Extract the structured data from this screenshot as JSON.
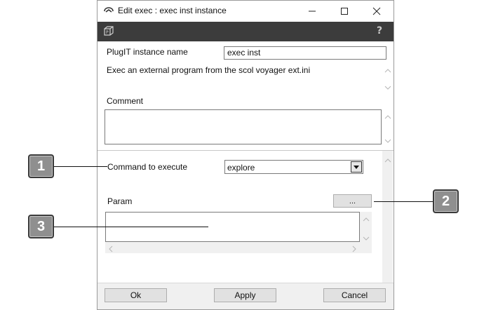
{
  "window": {
    "title": "Edit exec : exec inst instance",
    "minimize_icon": "minimize-icon",
    "maximize_icon": "maximize-icon",
    "close_icon": "close-icon"
  },
  "toolbar": {
    "left_icon": "cube-icon",
    "help_glyph": "?"
  },
  "form": {
    "instance_name_label": "PlugIT instance name",
    "instance_name_value": "exec inst",
    "description": "Exec an external program from the scol voyager ext.ini",
    "comment_label": "Comment",
    "comment_value": "",
    "command_label": "Command to execute",
    "command_value": "explore",
    "param_label": "Param",
    "param_browse_label": "...",
    "param_value": ""
  },
  "buttons": {
    "ok": "Ok",
    "apply": "Apply",
    "cancel": "Cancel"
  },
  "callouts": [
    "1",
    "2",
    "3"
  ]
}
